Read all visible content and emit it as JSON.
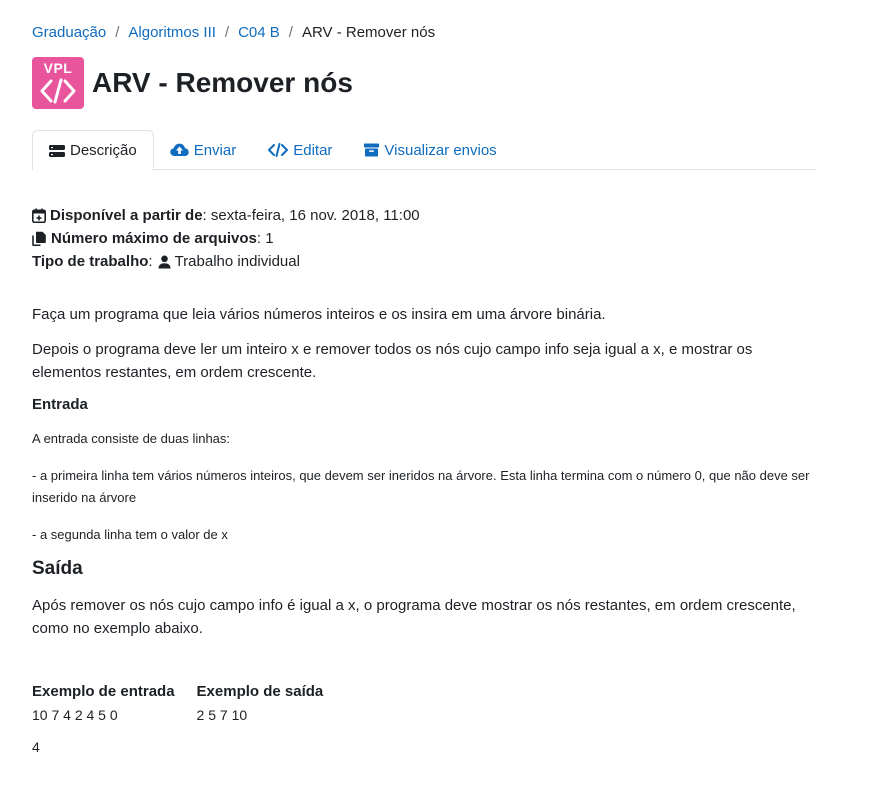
{
  "breadcrumb": {
    "items": [
      "Graduação",
      "Algoritmos III",
      "C04 B"
    ],
    "separator": "/",
    "current": "ARV - Remover nós"
  },
  "header": {
    "logo_text": "VPL",
    "title": "ARV - Remover nós"
  },
  "tabs": [
    {
      "label": "Descrição",
      "icon": "list-icon",
      "active": true
    },
    {
      "label": "Enviar",
      "icon": "cloud-upload-icon",
      "active": false
    },
    {
      "label": "Editar",
      "icon": "code-icon",
      "active": false
    },
    {
      "label": "Visualizar envios",
      "icon": "archive-icon",
      "active": false
    }
  ],
  "meta": {
    "available_label": "Disponível a partir de",
    "available_value": ": sexta-feira, 16 nov. 2018, 11:00",
    "max_files_label": "Número máximo de arquivos",
    "max_files_value": ": 1",
    "work_type_label": "Tipo de trabalho",
    "work_type_sep": ":",
    "work_type_value": "Trabalho individual"
  },
  "content": {
    "p1": "Faça um programa que leia vários números inteiros e os insira em uma árvore binária.",
    "p2": "Depois o programa deve ler um inteiro x e remover todos os nós cujo campo info seja igual a x, e mostrar os elementos restantes, em ordem crescente.",
    "entrada_heading": "Entrada",
    "entrada_p1": "A entrada consiste de duas linhas:",
    "entrada_p2": "- a primeira linha tem vários números inteiros, que devem ser ineridos na árvore. Esta linha termina com o número 0, que não deve ser inserido na árvore",
    "entrada_p3": "- a segunda linha tem o valor de x",
    "saida_heading": "Saída",
    "saida_p1": "Após remover os nós cujo campo info é igual a x, o programa deve mostrar os nós restantes, em ordem crescente, como no exemplo abaixo."
  },
  "example": {
    "input_header": "Exemplo de entrada",
    "output_header": "Exemplo de saída",
    "input_line1": "10 7 4 2 4 5 0",
    "input_line2": "4",
    "output_line1": "2 5 7 10"
  },
  "colors": {
    "link": "#0f6cbf",
    "logo_bg": "#e8559d",
    "text": "#1d2125"
  }
}
